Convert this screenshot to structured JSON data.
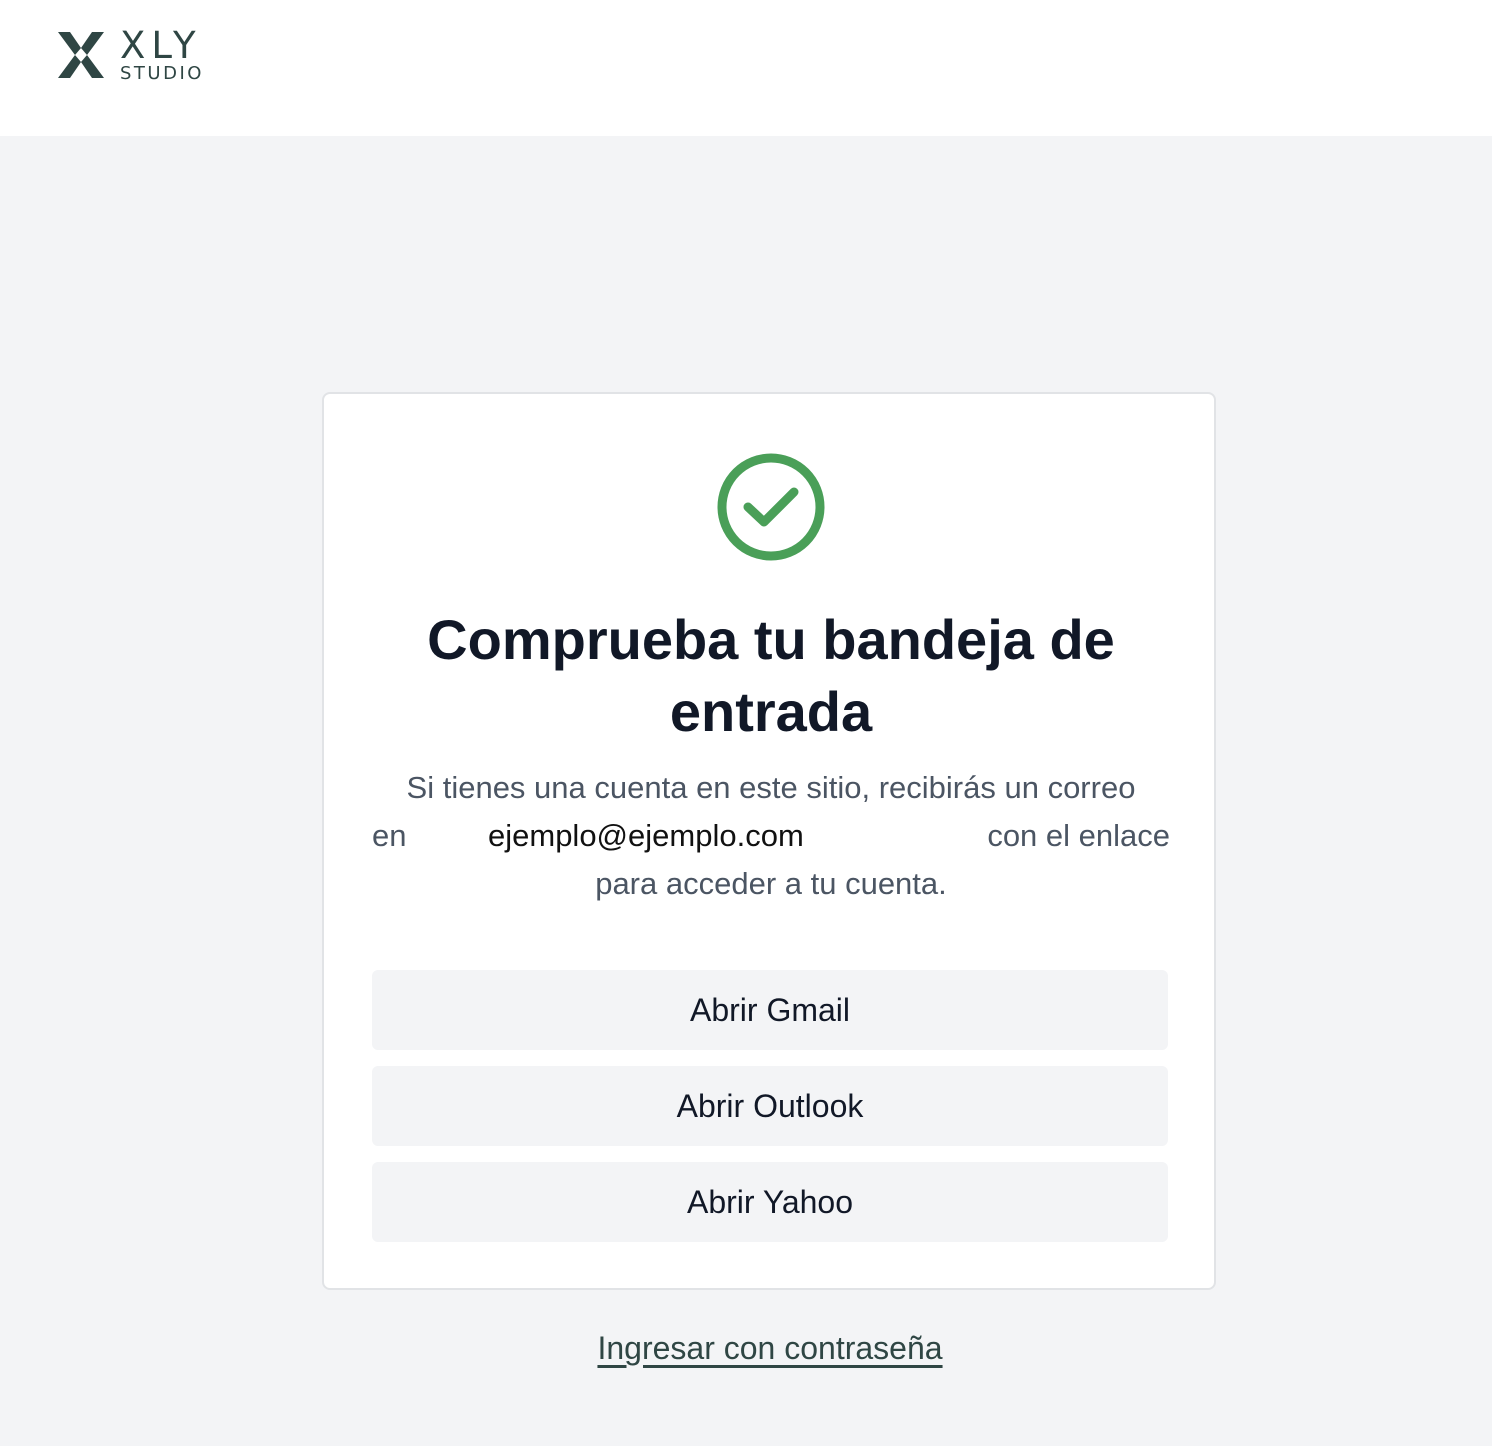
{
  "brand": {
    "logo_icon": "xly-x-logo-icon",
    "title": "XLY",
    "subtitle": "STUDIO",
    "color": "#2f4644"
  },
  "card": {
    "status_icon": "check-circle-icon",
    "status_color": "#4a9f58",
    "title": "Comprueba tu bandeja de entrada",
    "message_line1": "Si tienes una cuenta en este sitio, recibirás un correo",
    "message_prefix": "en",
    "email": "ejemplo@ejemplo.com",
    "message_suffix": "con el enlace",
    "message_line3": "para acceder a tu cuenta.",
    "buttons": [
      {
        "label": "Abrir Gmail"
      },
      {
        "label": "Abrir Outlook"
      },
      {
        "label": "Abrir Yahoo"
      }
    ]
  },
  "footer": {
    "password_link": "Ingresar con contraseña"
  }
}
